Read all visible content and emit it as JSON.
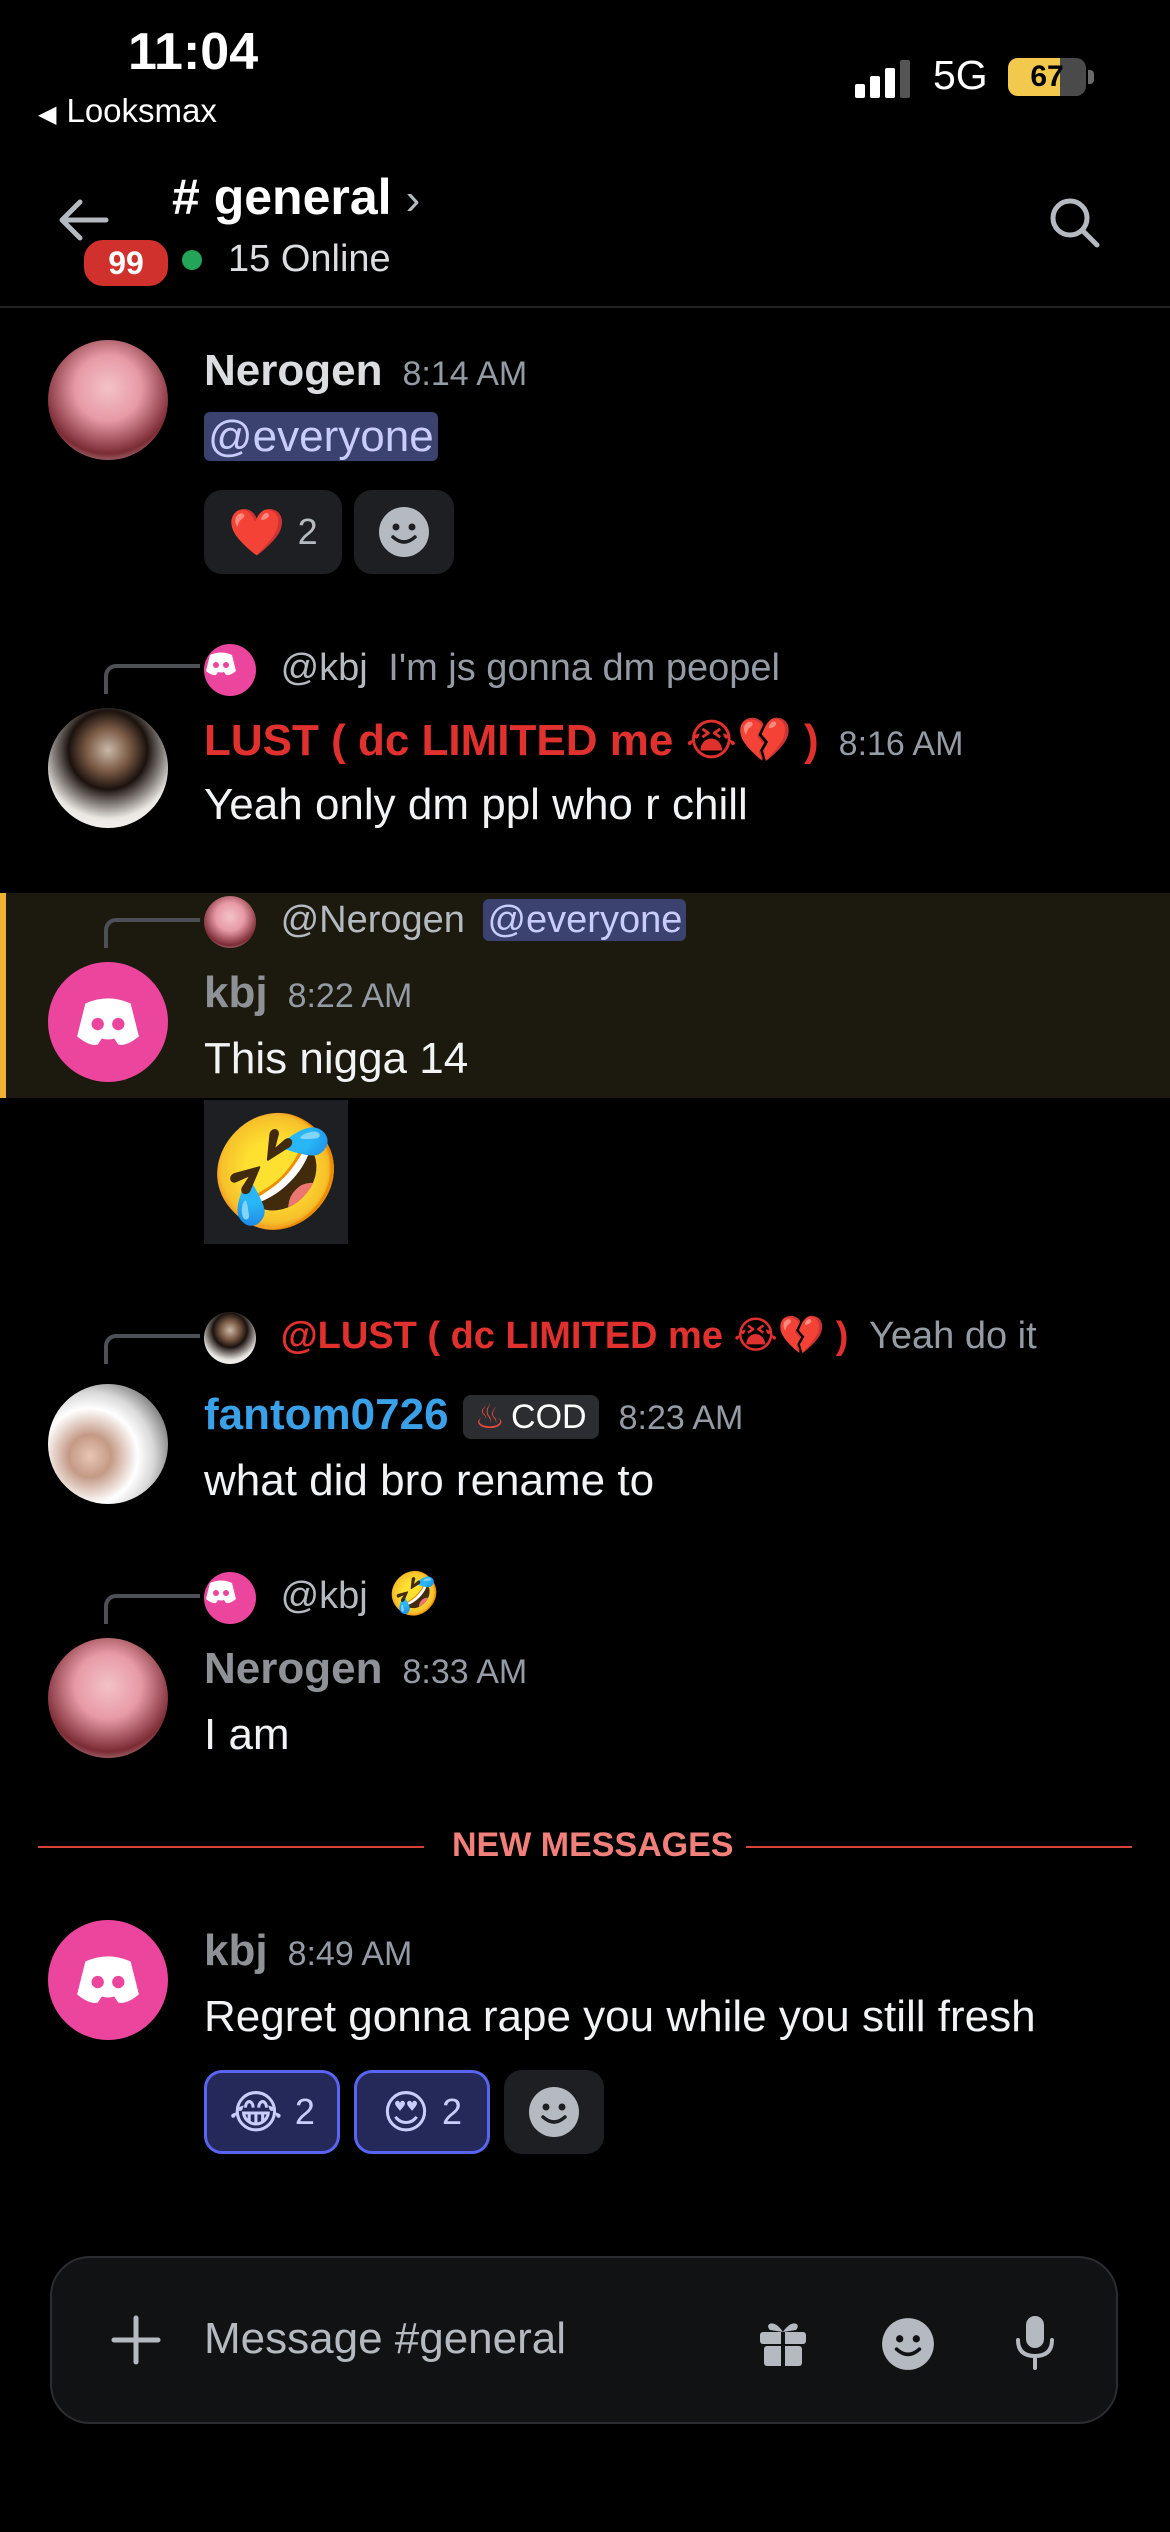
{
  "status_bar": {
    "time": "11:04",
    "back_app": "Looksmax",
    "network": "5G",
    "battery": "67",
    "battery_level": 0.67
  },
  "header": {
    "channel": "# general",
    "unread_badge": "99",
    "online": "15 Online",
    "online_color": "#23a559"
  },
  "messages": [
    {
      "author": "Nerogen",
      "author_color": "#8e9297",
      "time": "8:14 AM",
      "content": "@everyone",
      "reactions": [
        {
          "emoji": "❤️",
          "count": "2"
        }
      ]
    },
    {
      "reply": {
        "name": "@kbj",
        "text": "I'm js gonna dm peopel"
      },
      "author": "LUST (  dc LIMITED me 😭💔  )",
      "author_color": "#e0312e",
      "time": "8:16 AM",
      "content": "Yeah only dm ppl who r chill"
    },
    {
      "reply": {
        "name": "@Nerogen",
        "mention": "@everyone"
      },
      "author": "kbj",
      "author_color": "#8e9297",
      "time": "8:22 AM",
      "content": "This nigga 14",
      "sticker": "🤣"
    },
    {
      "reply": {
        "name": "@LUST (  dc LIMITED me 😭💔  )",
        "text": "Yeah do it"
      },
      "author": "fantom0726",
      "author_color": "#3aa0e8",
      "tag": "COD",
      "time": "8:23 AM",
      "content": "what did bro rename to"
    },
    {
      "reply": {
        "name": "@kbj",
        "emoji": "🤣"
      },
      "author": "Nerogen",
      "author_color": "#8e9297",
      "time": "8:33 AM",
      "content": "I am"
    },
    {
      "author": "kbj",
      "author_color": "#8e9297",
      "time": "8:49 AM",
      "content": "Regret gonna rape you while you still fresh",
      "reactions": [
        {
          "emoji": "😂",
          "count": "2"
        },
        {
          "emoji": "😍",
          "count": "2"
        }
      ]
    }
  ],
  "divider": "NEW MESSAGES",
  "composer": {
    "placeholder": "Message #general"
  },
  "icons": [
    "back-arrow-icon",
    "search-icon",
    "discord-icon",
    "add-reaction-icon",
    "plus-icon",
    "gift-icon",
    "emoji-icon",
    "microphone-icon"
  ]
}
